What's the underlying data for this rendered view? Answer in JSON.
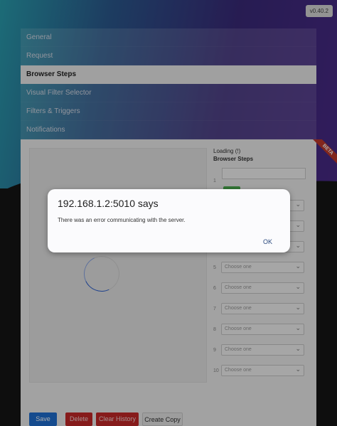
{
  "version": "v0.40.2",
  "tabs": [
    {
      "label": "General"
    },
    {
      "label": "Request"
    },
    {
      "label": "Browser Steps"
    },
    {
      "label": "Visual Filter Selector"
    },
    {
      "label": "Filters & Triggers"
    },
    {
      "label": "Notifications"
    }
  ],
  "beta_label": "BETA",
  "steps_panel": {
    "loading": "Loading (!)",
    "title": "Browser Steps",
    "first_row_number": "1",
    "rows": [
      {
        "num": "",
        "placeholder": ""
      },
      {
        "num": "",
        "placeholder": ""
      },
      {
        "num": "",
        "placeholder": ""
      },
      {
        "num": "5",
        "placeholder": "Choose one"
      },
      {
        "num": "6",
        "placeholder": "Choose one"
      },
      {
        "num": "7",
        "placeholder": "Choose one"
      },
      {
        "num": "8",
        "placeholder": "Choose one"
      },
      {
        "num": "9",
        "placeholder": "Choose one"
      },
      {
        "num": "10",
        "placeholder": "Choose one"
      }
    ]
  },
  "buttons": {
    "save": "Save",
    "delete": "Delete",
    "clear_history": "Clear History",
    "create_copy": "Create Copy"
  },
  "dialog": {
    "title": "192.168.1.2:5010 says",
    "message": "There was an error communicating with the server.",
    "ok": "OK"
  },
  "colors": {
    "accent": "#1f6fd1",
    "danger": "#c62828",
    "success": "#4caf50"
  }
}
